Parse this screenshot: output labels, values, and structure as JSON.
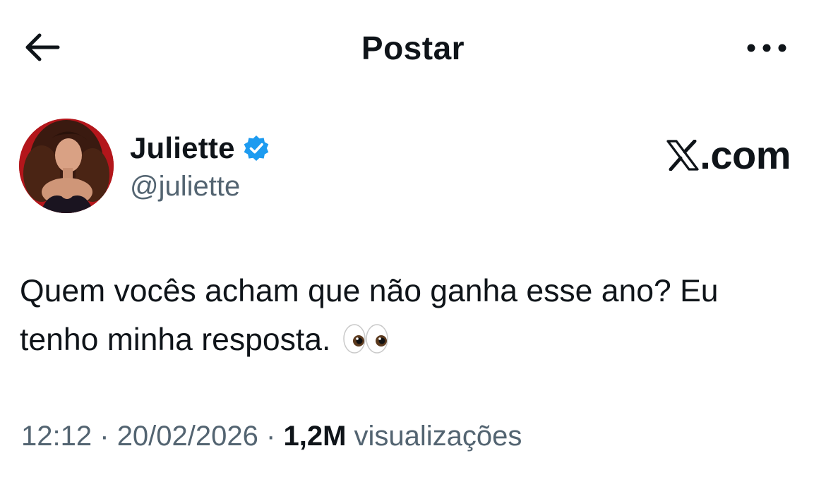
{
  "header": {
    "title": "Postar",
    "back_icon": "arrow-left-icon",
    "more_icon": "more-horizontal-icon"
  },
  "author": {
    "display_name": "Juliette",
    "handle": "@juliette",
    "verified": true,
    "verified_color": "#1d9bf0"
  },
  "watermark": {
    "suffix": ".com"
  },
  "tweet": {
    "line1": "Quem vocês acham que não ganha esse ano? Eu",
    "line2": "tenho minha resposta.",
    "emoji": "eyes-emoji"
  },
  "meta": {
    "time": "12:12",
    "separator": "·",
    "date": "20/02/2026",
    "views_count": "1,2M",
    "views_label": "visualizações"
  },
  "colors": {
    "primary_text": "#0f1419",
    "secondary_text": "#536471",
    "avatar_background": "#b3161b"
  }
}
